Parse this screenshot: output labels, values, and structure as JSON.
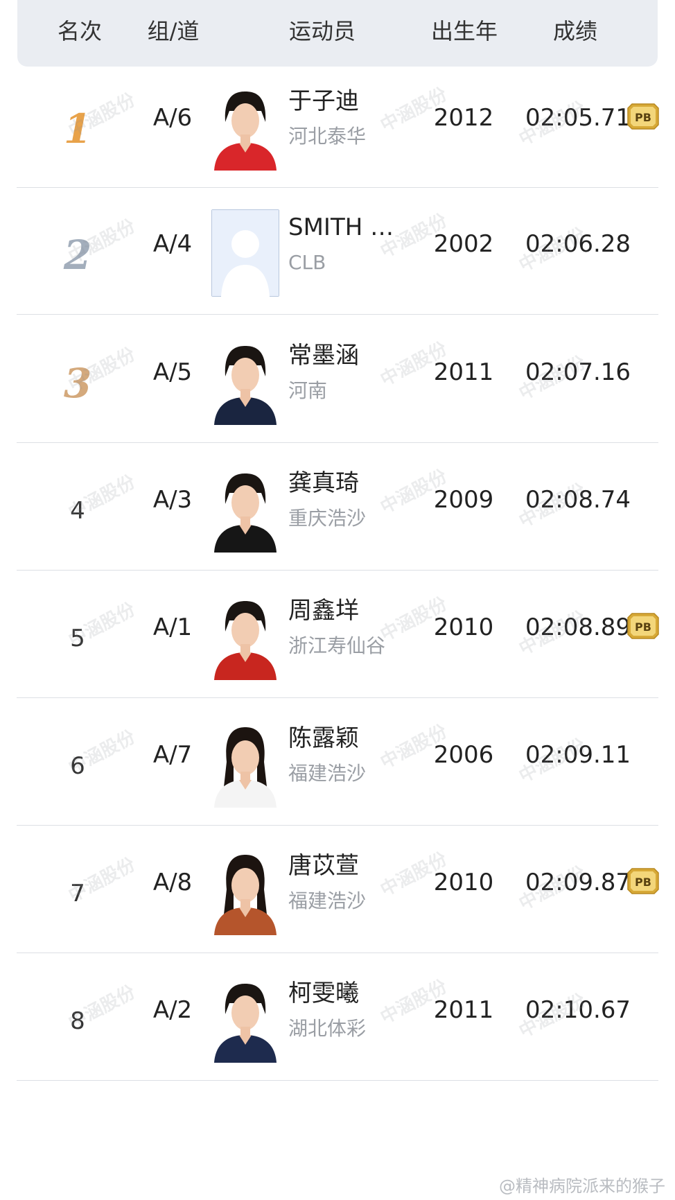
{
  "columns": {
    "rank": "名次",
    "lane": "组/道",
    "athlete": "运动员",
    "birth_year": "出生年",
    "result": "成绩"
  },
  "rows": [
    {
      "rank": "1",
      "lane": "A/6",
      "name": "于子迪",
      "team": "河北泰华",
      "birth_year": "2012",
      "result": "02:05.71",
      "pb": true,
      "shirt_color": "#d9262a",
      "hair": "short"
    },
    {
      "rank": "2",
      "lane": "A/4",
      "name": "SMITH …",
      "team": "CLB",
      "birth_year": "2002",
      "result": "02:06.28",
      "pb": false,
      "shirt_color": "#ffffff",
      "hair": "placeholder"
    },
    {
      "rank": "3",
      "lane": "A/5",
      "name": "常墨涵",
      "team": "河南",
      "birth_year": "2011",
      "result": "02:07.16",
      "pb": false,
      "shirt_color": "#1a2540",
      "hair": "short"
    },
    {
      "rank": "4",
      "lane": "A/3",
      "name": "龚真琦",
      "team": "重庆浩沙",
      "birth_year": "2009",
      "result": "02:08.74",
      "pb": false,
      "shirt_color": "#161616",
      "hair": "short"
    },
    {
      "rank": "5",
      "lane": "A/1",
      "name": "周鑫垟",
      "team": "浙江寿仙谷",
      "birth_year": "2010",
      "result": "02:08.89",
      "pb": true,
      "shirt_color": "#c8261f",
      "hair": "short"
    },
    {
      "rank": "6",
      "lane": "A/7",
      "name": "陈露颖",
      "team": "福建浩沙",
      "birth_year": "2006",
      "result": "02:09.11",
      "pb": false,
      "shirt_color": "#f4f4f4",
      "hair": "long"
    },
    {
      "rank": "7",
      "lane": "A/8",
      "name": "唐苡萱",
      "team": "福建浩沙",
      "birth_year": "2010",
      "result": "02:09.87",
      "pb": true,
      "shirt_color": "#b5552c",
      "hair": "long"
    },
    {
      "rank": "8",
      "lane": "A/2",
      "name": "柯雯曦",
      "team": "湖北体彩",
      "birth_year": "2011",
      "result": "02:10.67",
      "pb": false,
      "shirt_color": "#1e2b4e",
      "hair": "short"
    }
  ],
  "badges": {
    "pb": "PB"
  },
  "watermark": "中涵股份",
  "credit": "@精神病院派来的猴子",
  "colors": {
    "header_bg": "#eaedf2",
    "gold": "#e8a24a",
    "silver": "#a3aebc",
    "bronze": "#d4a97c",
    "divider": "#dcdfe4",
    "team_text": "#9a9ea4",
    "pb_gold": "#d7a937"
  }
}
